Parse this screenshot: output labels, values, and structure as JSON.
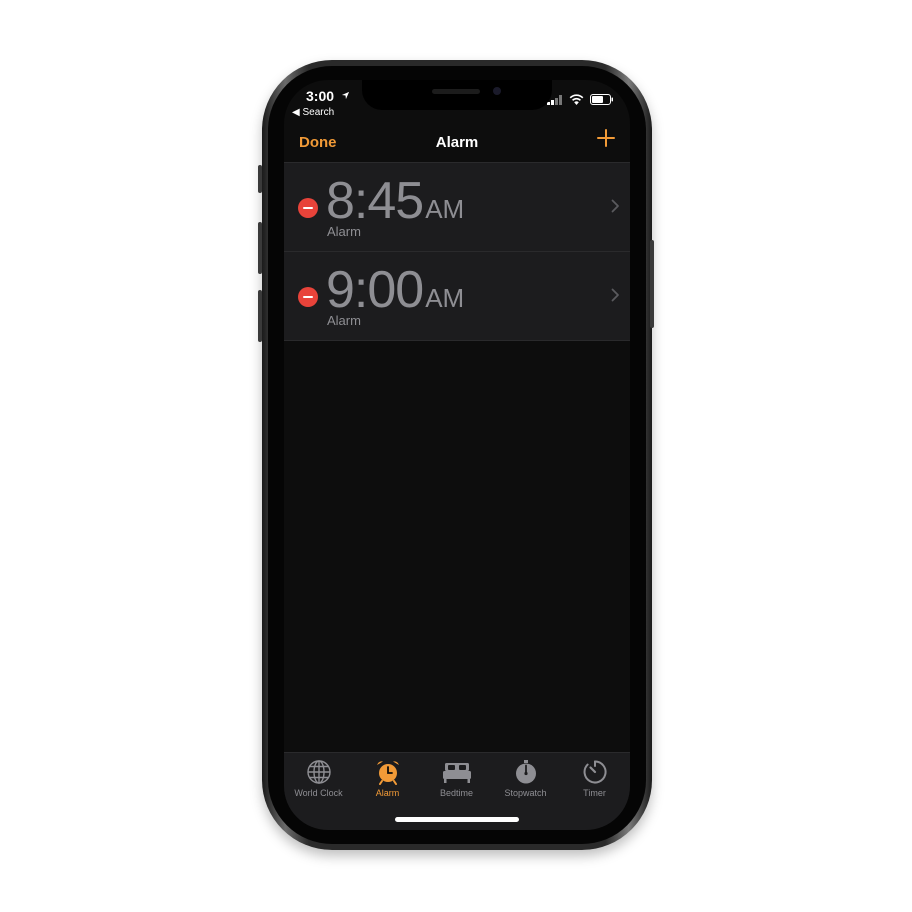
{
  "status_bar": {
    "time": "3:00",
    "back_link": "◀ Search"
  },
  "nav": {
    "left_button": "Done",
    "title": "Alarm"
  },
  "alarms": [
    {
      "time": "8:45",
      "period": "AM",
      "label": "Alarm"
    },
    {
      "time": "9:00",
      "period": "AM",
      "label": "Alarm"
    }
  ],
  "tabs": [
    {
      "label": "World Clock",
      "icon": "globe-icon",
      "active": false
    },
    {
      "label": "Alarm",
      "icon": "alarm-clock-icon",
      "active": true
    },
    {
      "label": "Bedtime",
      "icon": "bed-icon",
      "active": false
    },
    {
      "label": "Stopwatch",
      "icon": "stopwatch-icon",
      "active": false
    },
    {
      "label": "Timer",
      "icon": "timer-icon",
      "active": false
    }
  ],
  "colors": {
    "accent": "#f19a37",
    "delete": "#e8433a",
    "background": "#0d0d0d",
    "row": "#1c1c1e",
    "secondary_text": "#8e8e93"
  }
}
